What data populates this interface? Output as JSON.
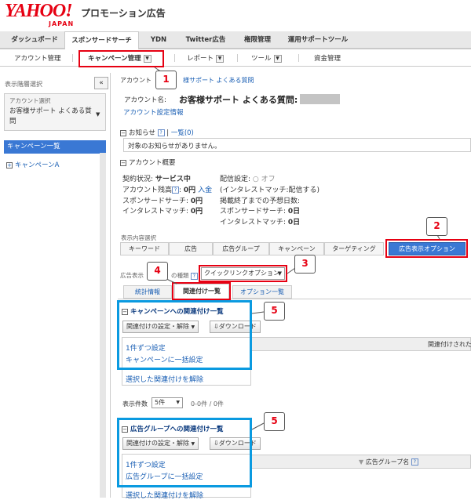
{
  "brand": {
    "logo_text": "YAHOO!",
    "logo_sub": "JAPAN",
    "product": "プロモーション広告"
  },
  "global_tabs": [
    {
      "label": "ダッシュボード"
    },
    {
      "label": "スポンサードサーチ",
      "active": true
    },
    {
      "label": "YDN"
    },
    {
      "label": "Twitter広告"
    },
    {
      "label": "権限管理"
    },
    {
      "label": "運用サポートツール"
    }
  ],
  "subnav": {
    "account": "アカウント管理",
    "campaign": "キャンペーン管理",
    "report": "レポート",
    "tools": "ツール",
    "funds": "資金管理"
  },
  "callouts": [
    "1",
    "2",
    "3",
    "4",
    "5",
    "5"
  ],
  "sidebar": {
    "title": "表示階層選択",
    "collapse": "«",
    "account_label": "アカウント選択",
    "account_value": "お客様サポート よくある質問",
    "list_header": "キャンペーン一覧",
    "items": [
      {
        "label": "キャンペーンA"
      }
    ]
  },
  "account": {
    "breadcrumb_prefix": "アカウント",
    "breadcrumb_link": "様サポート よくある質問",
    "name_label": "アカウント名:",
    "name_value": "お客様サポート よくある質問:",
    "settings_link": "アカウント設定情報"
  },
  "notice": {
    "title": "お知らせ",
    "list_link": "一覧(0)",
    "help": "?",
    "empty": "対象のお知らせがありません。"
  },
  "overview": {
    "title": "アカウント概要",
    "status_label": "契約状況:",
    "status_value": "サービス中",
    "balance_label": "アカウント残高",
    "balance_value": "0円",
    "deposit_link": "入金",
    "ss_label": "スポンサードサーチ:",
    "ss_value": "0円",
    "im_label": "インタレストマッチ:",
    "im_value": "0円",
    "delivery_label": "配信設定:",
    "delivery_value": "○ オフ",
    "delivery_note": "(インタレストマッチ:配信する)",
    "days_label": "掲載終了までの予想日数:",
    "days_ss_label": "スポンサードサーチ:",
    "days_ss_value": "0日",
    "days_im_label": "インタレストマッチ:",
    "days_im_value": "0日"
  },
  "display": {
    "label": "表示内容選択",
    "tabs": [
      "キーワード",
      "広告",
      "広告グループ",
      "キャンペーン",
      "ターゲティング",
      "広告表示オプション"
    ],
    "type_label_a": "広告表示",
    "type_label_b": "の種類",
    "type_value": "クイックリンクオプション",
    "inner_tabs": [
      "統計情報",
      "関連付け一覧",
      "オプション一覧"
    ]
  },
  "campaign_assoc": {
    "title": "キャンペーンへの関連付け一覧",
    "set_button": "関連付けの設定・解除",
    "download_button": "ダウンロード",
    "menu": [
      "1件ずつ設定",
      "キャンペーンに一括設定"
    ],
    "col_right": "関連付けされた",
    "unlink": "選択した関連付けを解除",
    "count_label": "表示件数",
    "count_value": "5件",
    "range": "0-0件 / 0件"
  },
  "adgroup_assoc": {
    "title": "広告グループへの関連付け一覧",
    "set_button": "関連付けの設定・解除",
    "download_button": "ダウンロード",
    "menu": [
      "1件ずつ設定",
      "広告グループに一括設定"
    ],
    "col_right": "広告グループ名",
    "unlink": "選択した関連付けを解除"
  },
  "colors": {
    "red": "#e60012",
    "blue": "#0a9ae0",
    "link": "#1a5fb4",
    "active_tab": "#3a78d4"
  }
}
